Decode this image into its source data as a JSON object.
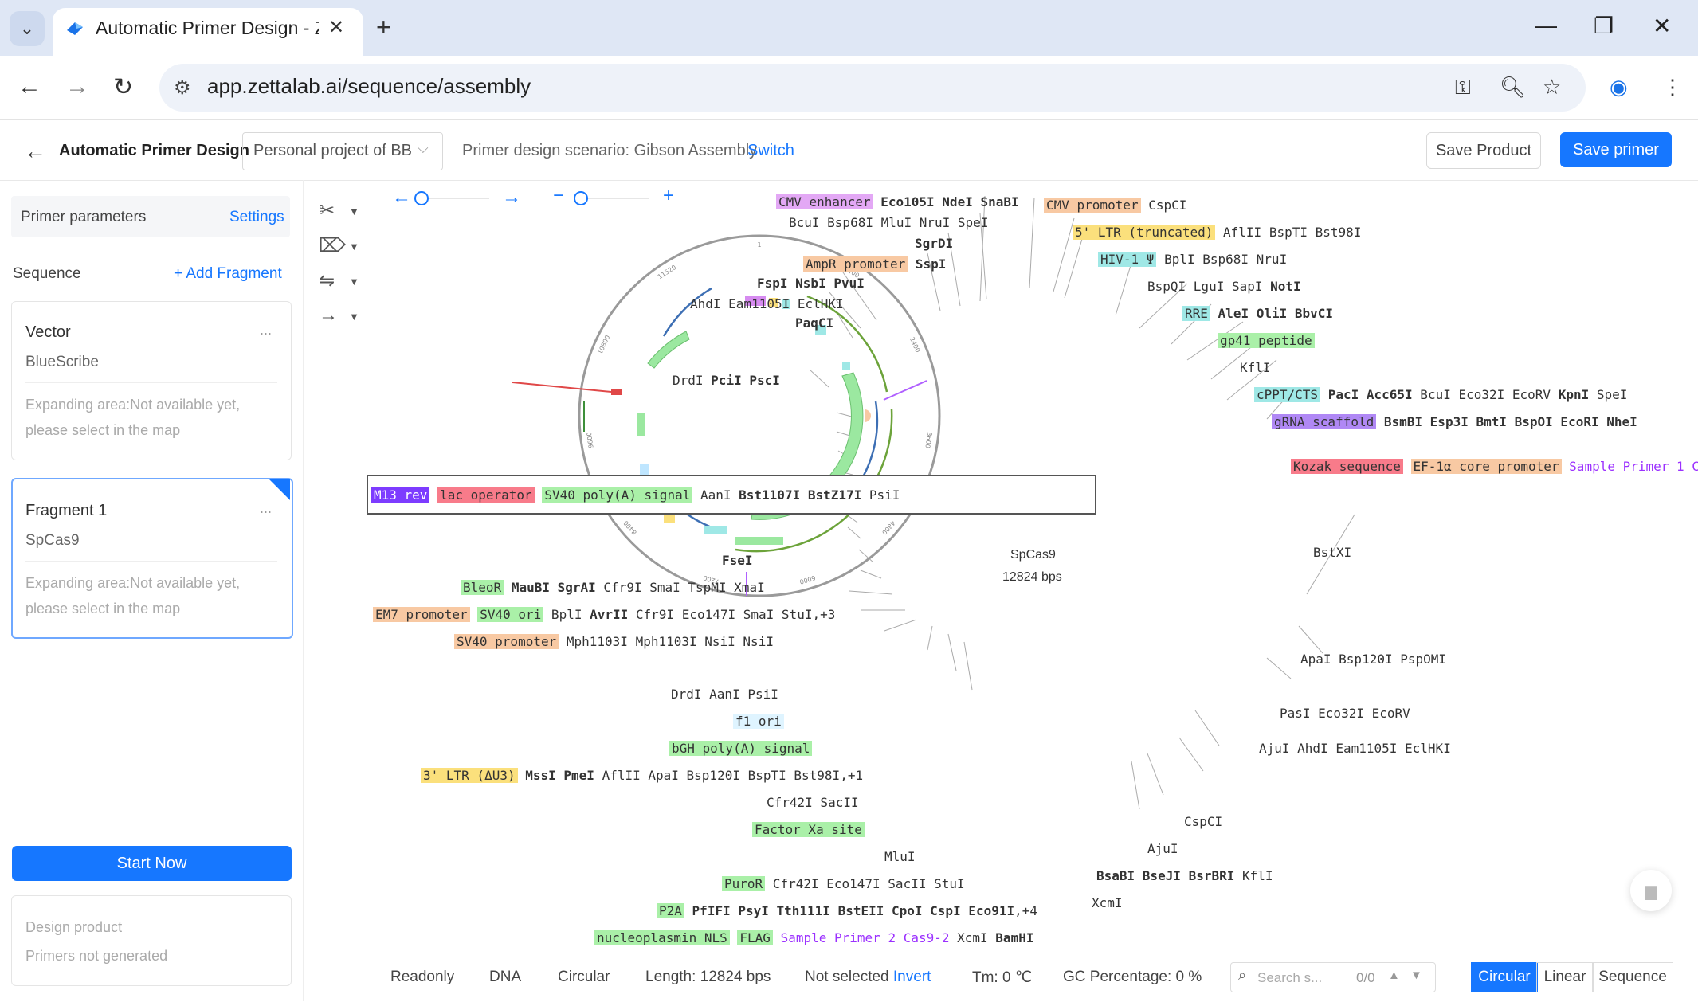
{
  "browser": {
    "tab_title": "Automatic Primer Design - Ze",
    "url": "app.zettalab.ai/sequence/assembly"
  },
  "header": {
    "title": "Automatic Primer Design",
    "project": "Personal project of BB",
    "scenario": "Primer design scenario: Gibson Assembly",
    "switch": "Switch",
    "save_product": "Save Product",
    "save_primer": "Save primer"
  },
  "left": {
    "params_label": "Primer parameters",
    "settings": "Settings",
    "sequence_label": "Sequence",
    "add_fragment": "Add Fragment",
    "cards": [
      {
        "title": "Vector",
        "name": "BlueScribe",
        "dots": "...",
        "hint1": "Expanding area:Not available yet,",
        "hint2": "please select in the map"
      },
      {
        "title": "Fragment 1",
        "name": "SpCas9",
        "dots": "...",
        "hint1": "Expanding area:Not available yet,",
        "hint2": "please select in the map"
      }
    ],
    "start_now": "Start Now",
    "design_product": "Design product",
    "primers_not_generated": "Primers not generated"
  },
  "map": {
    "name": "SpCas9",
    "length": "12824 bps",
    "hover_labels": {
      "m13": "M13 rev",
      "lac": "lac operator",
      "sv40": "SV40 poly(A) signal",
      "rest1": " AanI ",
      "bold": "Bst1107I BstZ17I",
      "rest2": " PsiI"
    },
    "ticks": [
      "1",
      "1200",
      "2400",
      "3600",
      "4800",
      "6000",
      "7200",
      "8400",
      "9600",
      "10800",
      "11520"
    ]
  },
  "status": {
    "readonly": "Readonly",
    "dna": "DNA",
    "circular": "Circular",
    "length": "Length: 12824 bps",
    "not_selected": "Not selected",
    "invert": "Invert",
    "tm": "Tm: 0 ℃",
    "gc": "GC Percentage: 0 %",
    "search_placeholder": "Search s...",
    "search_count": "0/0",
    "views": [
      "Circular",
      "Linear",
      "Sequence"
    ]
  },
  "colors": {
    "accent": "#1677ff",
    "cas9": "#9be8a0",
    "backbone": "#999999"
  }
}
